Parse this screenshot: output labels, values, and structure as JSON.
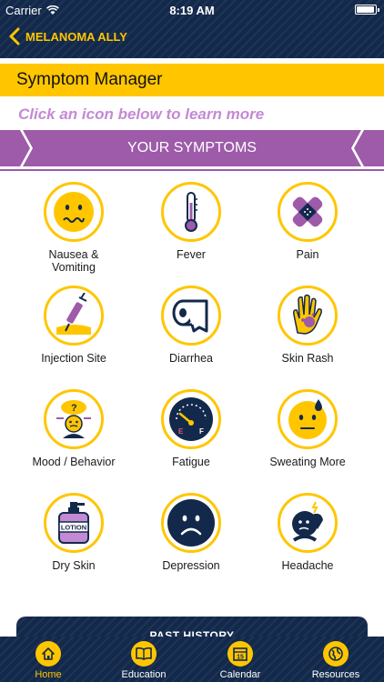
{
  "status_bar": {
    "carrier": "Carrier",
    "time": "8:19 AM",
    "battery_level": 0.95
  },
  "nav": {
    "back_label": "MELANOMA ALLY"
  },
  "header": {
    "title": "Symptom Manager",
    "hint": "Click an icon below to learn more",
    "banner": "YOUR SYMPTOMS"
  },
  "symptoms": [
    {
      "label": "Nausea &\nVomiting",
      "icon": "nausea-face-icon"
    },
    {
      "label": "Fever",
      "icon": "thermometer-icon"
    },
    {
      "label": "Pain",
      "icon": "bandage-icon"
    },
    {
      "label": "Injection Site",
      "icon": "syringe-icon"
    },
    {
      "label": "Diarrhea",
      "icon": "toilet-paper-icon"
    },
    {
      "label": "Skin Rash",
      "icon": "rash-hand-icon"
    },
    {
      "label": "Mood / Behavior",
      "icon": "confused-person-icon"
    },
    {
      "label": "Fatigue",
      "icon": "fuel-gauge-icon"
    },
    {
      "label": "Sweating More",
      "icon": "sweating-face-icon"
    },
    {
      "label": "Dry Skin",
      "icon": "lotion-bottle-icon"
    },
    {
      "label": "Depression",
      "icon": "sad-face-icon"
    },
    {
      "label": "Headache",
      "icon": "headache-icon"
    }
  ],
  "lotion_text": "LOTION",
  "fuel_labels": {
    "empty": "E",
    "full": "F"
  },
  "past_history": "PAST HISTORY",
  "tabs": [
    {
      "label": "Home",
      "icon": "home-icon",
      "active": true
    },
    {
      "label": "Education",
      "icon": "book-icon",
      "active": false
    },
    {
      "label": "Calendar",
      "icon": "calendar-icon",
      "active": false,
      "badge": "15"
    },
    {
      "label": "Resources",
      "icon": "globe-icon",
      "active": false
    }
  ],
  "colors": {
    "navy": "#13294b",
    "gold": "#ffc600",
    "purple": "#9d5ba9",
    "lavender": "#c38ad4"
  }
}
